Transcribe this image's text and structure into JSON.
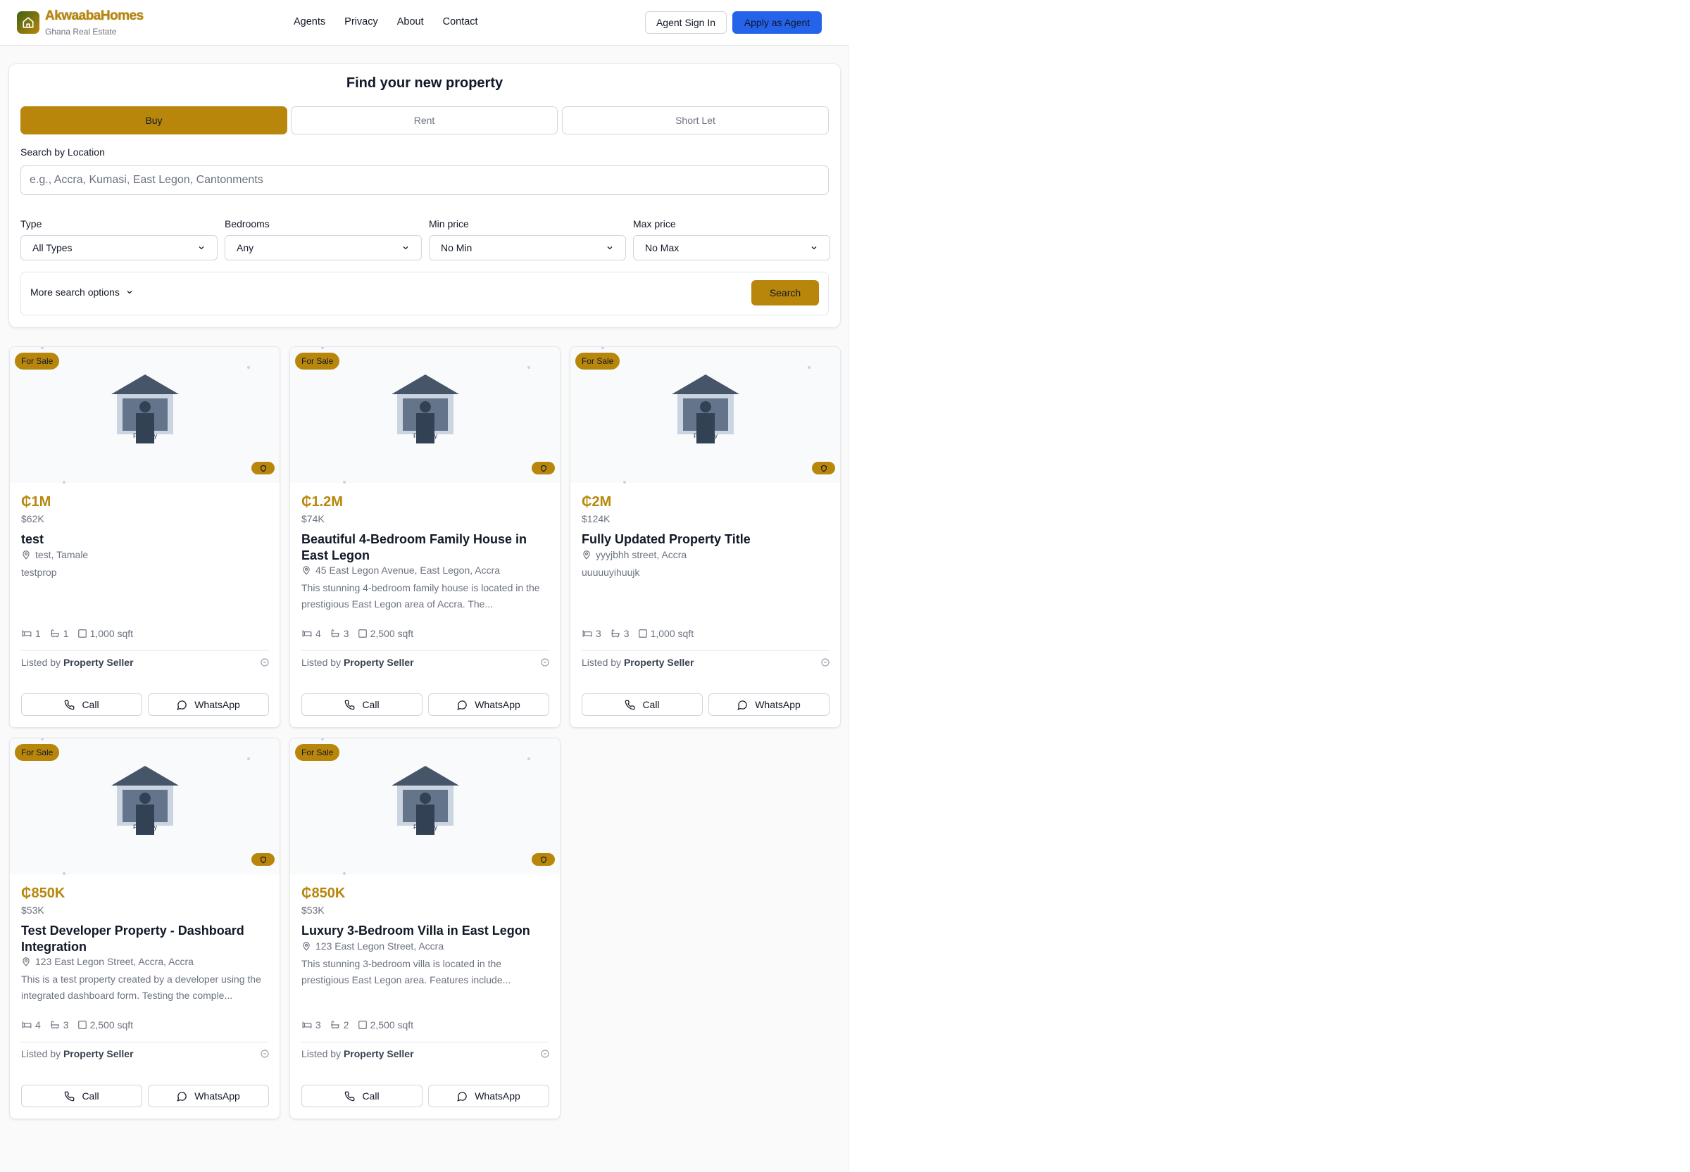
{
  "header": {
    "brand_name": "AkwaabaHomes",
    "brand_sub": "Ghana Real Estate",
    "nav": [
      "Agents",
      "Privacy",
      "About",
      "Contact"
    ],
    "signin_label": "Agent Sign In",
    "apply_label": "Apply as Agent"
  },
  "search": {
    "title": "Find your new property",
    "tabs": [
      {
        "label": "Buy",
        "active": true
      },
      {
        "label": "Rent",
        "active": false
      },
      {
        "label": "Short Let",
        "active": false
      }
    ],
    "location_label": "Search by Location",
    "location_placeholder": "e.g., Accra, Kumasi, East Legon, Cantonments",
    "filters": [
      {
        "label": "Type",
        "value": "All Types"
      },
      {
        "label": "Bedrooms",
        "value": "Any"
      },
      {
        "label": "Min price",
        "value": "No Min"
      },
      {
        "label": "Max price",
        "value": "No Max"
      }
    ],
    "more_options_label": "More search options",
    "search_button": "Search"
  },
  "listings": [
    {
      "badge": "For Sale",
      "image_label": "Property",
      "price": "₵1M",
      "usd": "$62K",
      "title": "test",
      "address": "test, Tamale",
      "description": "testprop",
      "beds": "1",
      "baths": "1",
      "area": "1,000 sqft",
      "listed_prefix": "Listed by",
      "seller": "Property Seller",
      "call": "Call",
      "whatsapp": "WhatsApp"
    },
    {
      "badge": "For Sale",
      "image_label": "Property",
      "price": "₵1.2M",
      "usd": "$74K",
      "title": "Beautiful 4-Bedroom Family House in East Legon",
      "address": "45 East Legon Avenue, East Legon, Accra",
      "description": "This stunning 4-bedroom family house is located in the prestigious East Legon area of Accra. The...",
      "beds": "4",
      "baths": "3",
      "area": "2,500 sqft",
      "listed_prefix": "Listed by",
      "seller": "Property Seller",
      "call": "Call",
      "whatsapp": "WhatsApp"
    },
    {
      "badge": "For Sale",
      "image_label": "Property",
      "price": "₵2M",
      "usd": "$124K",
      "title": "Fully Updated Property Title",
      "address": "yyyjbhh street, Accra",
      "description": "uuuuuyihuujk",
      "beds": "3",
      "baths": "3",
      "area": "1,000 sqft",
      "listed_prefix": "Listed by",
      "seller": "Property Seller",
      "call": "Call",
      "whatsapp": "WhatsApp"
    },
    {
      "badge": "For Sale",
      "image_label": "Property",
      "price": "₵850K",
      "usd": "$53K",
      "title": "Test Developer Property - Dashboard Integration",
      "address": "123 East Legon Street, Accra, Accra",
      "description": "This is a test property created by a developer using the integrated dashboard form. Testing the comple...",
      "beds": "4",
      "baths": "3",
      "area": "2,500 sqft",
      "listed_prefix": "Listed by",
      "seller": "Property Seller",
      "call": "Call",
      "whatsapp": "WhatsApp"
    },
    {
      "badge": "For Sale",
      "image_label": "Property",
      "price": "₵850K",
      "usd": "$53K",
      "title": "Luxury 3-Bedroom Villa in East Legon",
      "address": "123 East Legon Street, Accra",
      "description": "This stunning 3-bedroom villa is located in the prestigious East Legon area. Features include...",
      "beds": "3",
      "baths": "2",
      "area": "2,500 sqft",
      "listed_prefix": "Listed by",
      "seller": "Property Seller",
      "call": "Call",
      "whatsapp": "WhatsApp"
    }
  ],
  "colors": {
    "accent": "#b8860b",
    "primary_blue": "#2563eb",
    "muted_text": "#6b7280"
  }
}
